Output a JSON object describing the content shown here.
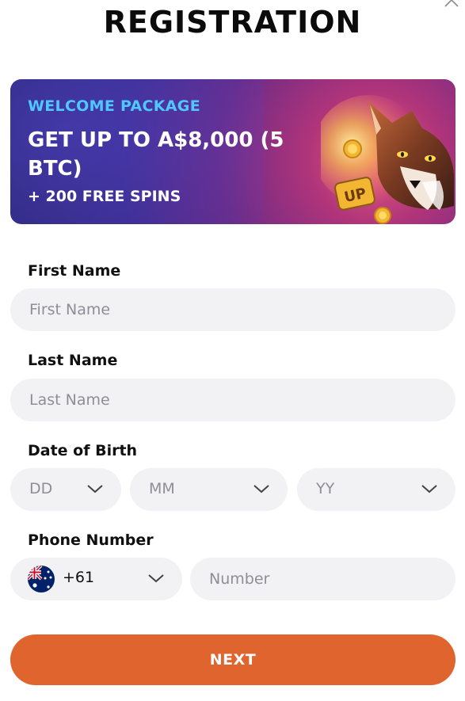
{
  "header": {
    "title": "REGISTRATION"
  },
  "banner": {
    "eyebrow": "WELCOME PACKAGE",
    "headline": "GET UP TO A$8,000 (5 BTC)",
    "subline": "+ 200 FREE SPINS",
    "art_badge": "UP"
  },
  "form": {
    "first_name": {
      "label": "First Name",
      "placeholder": "First Name",
      "value": ""
    },
    "last_name": {
      "label": "Last Name",
      "placeholder": "Last Name",
      "value": ""
    },
    "dob": {
      "label": "Date of Birth",
      "day_placeholder": "DD",
      "month_placeholder": "MM",
      "year_placeholder": "YY"
    },
    "phone": {
      "label": "Phone Number",
      "country_flag": "australia-flag-icon",
      "dial_code": "+61",
      "placeholder": "Number",
      "value": ""
    }
  },
  "actions": {
    "next_label": "NEXT"
  },
  "colors": {
    "accent": "#e0642e",
    "eyebrow": "#4fc7ff",
    "field_bg": "#f2f2f5",
    "banner_dark": "#2b2573"
  }
}
